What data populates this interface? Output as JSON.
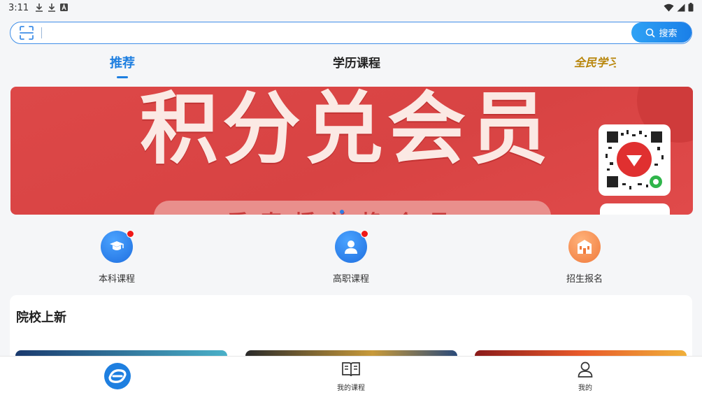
{
  "status_bar": {
    "time": "3:11"
  },
  "search": {
    "placeholder": "",
    "value": "",
    "button_label": "搜索"
  },
  "tabs": [
    {
      "label": "推荐",
      "active": true
    },
    {
      "label": "学历课程",
      "active": false
    },
    {
      "label": "全民学习",
      "active": false
    }
  ],
  "banner": {
    "headline": "积分兑会员",
    "subline": "看直播兑换会员",
    "accent_color": "#d84343"
  },
  "quick_entries": [
    {
      "label": "本科课程",
      "icon": "graduate-icon",
      "badge": true
    },
    {
      "label": "高职课程",
      "icon": "person-icon",
      "badge": true
    },
    {
      "label": "招生报名",
      "icon": "school-building-icon",
      "badge": false
    }
  ],
  "section": {
    "title": "院校上新"
  },
  "bottom_nav": [
    {
      "label": "",
      "icon": "home-logo-icon",
      "active": true
    },
    {
      "label": "我的课程",
      "icon": "book-icon",
      "active": false
    },
    {
      "label": "我的",
      "icon": "user-icon",
      "active": false
    }
  ],
  "colors": {
    "primary": "#1e7fe0",
    "badge": "#f01818",
    "orange": "#f07a3c"
  }
}
